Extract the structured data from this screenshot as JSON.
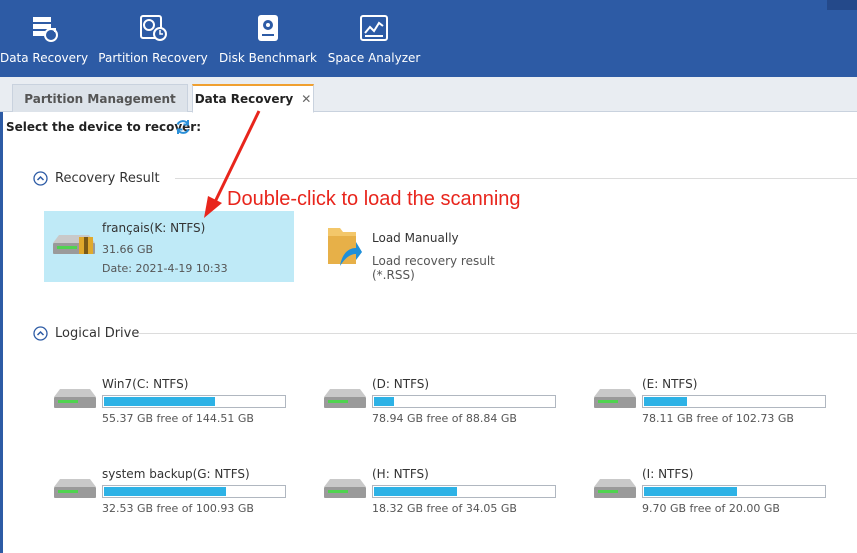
{
  "colors": {
    "toolbar_bg": "#2d5ba5",
    "selection_bg": "#bfeaf7",
    "bar_fill": "#2db2e6",
    "annotation": "#e8251c",
    "tab_accent": "#f0a030"
  },
  "toolbar": {
    "buttons": [
      {
        "label": "Data Recovery",
        "icon": "data-recovery-icon"
      },
      {
        "label": "Partition Recovery",
        "icon": "partition-recovery-icon"
      },
      {
        "label": "Disk Benchmark",
        "icon": "disk-benchmark-icon"
      },
      {
        "label": "Space Analyzer",
        "icon": "space-analyzer-icon"
      }
    ]
  },
  "tabs": [
    {
      "label": "Partition Management",
      "active": false
    },
    {
      "label": "Data Recovery",
      "active": true,
      "close": "✕"
    }
  ],
  "main": {
    "select_label": "Select the device to recover:",
    "refresh_icon": "refresh-icon"
  },
  "recovery_result": {
    "heading": "Recovery Result",
    "item": {
      "name": "français(K: NTFS)",
      "size": "31.66 GB",
      "date": "Date: 2021-4-19 10:33"
    },
    "load_manually": {
      "title": "Load Manually",
      "desc": "Load recovery result (*.RSS)"
    }
  },
  "annotation": "Double-click to load the scanning",
  "logical_drive": {
    "heading": "Logical Drive",
    "drives": [
      {
        "name": "Win7(C: NTFS)",
        "free": "55.37 GB free of 144.51 GB",
        "used_fraction": 0.617
      },
      {
        "name": "(D: NTFS)",
        "free": "78.94 GB free of 88.84 GB",
        "used_fraction": 0.111
      },
      {
        "name": "(E: NTFS)",
        "free": "78.11 GB free of 102.73 GB",
        "used_fraction": 0.24
      },
      {
        "name": "system backup(G: NTFS)",
        "free": "32.53 GB free of 100.93 GB",
        "used_fraction": 0.678
      },
      {
        "name": "(H: NTFS)",
        "free": "18.32 GB free of 34.05 GB",
        "used_fraction": 0.462
      },
      {
        "name": "(I: NTFS)",
        "free": "9.70 GB free of 20.00 GB",
        "used_fraction": 0.515
      }
    ]
  }
}
